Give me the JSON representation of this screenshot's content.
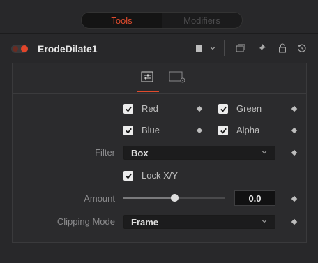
{
  "tabs": {
    "tools": "Tools",
    "modifiers": "Modifiers"
  },
  "header": {
    "tool_name": "ErodeDilate1",
    "icons": [
      "color-swatch-icon",
      "chevron-down-icon",
      "view-icon",
      "pin-icon",
      "lock-icon",
      "reset-icon"
    ]
  },
  "controls_tabs": [
    "controls-icon",
    "settings-icon"
  ],
  "channels": [
    {
      "label": "Red",
      "checked": true
    },
    {
      "label": "Green",
      "checked": true
    },
    {
      "label": "Blue",
      "checked": true
    },
    {
      "label": "Alpha",
      "checked": true
    }
  ],
  "filter": {
    "label": "Filter",
    "value": "Box"
  },
  "lock_xy": {
    "label": "Lock X/Y",
    "checked": true
  },
  "amount": {
    "label": "Amount",
    "value": "0.0",
    "slider_fraction": 0.5
  },
  "clipping": {
    "label": "Clipping Mode",
    "value": "Frame"
  },
  "colors": {
    "accent": "#e14b2d",
    "background": "#28282a"
  }
}
